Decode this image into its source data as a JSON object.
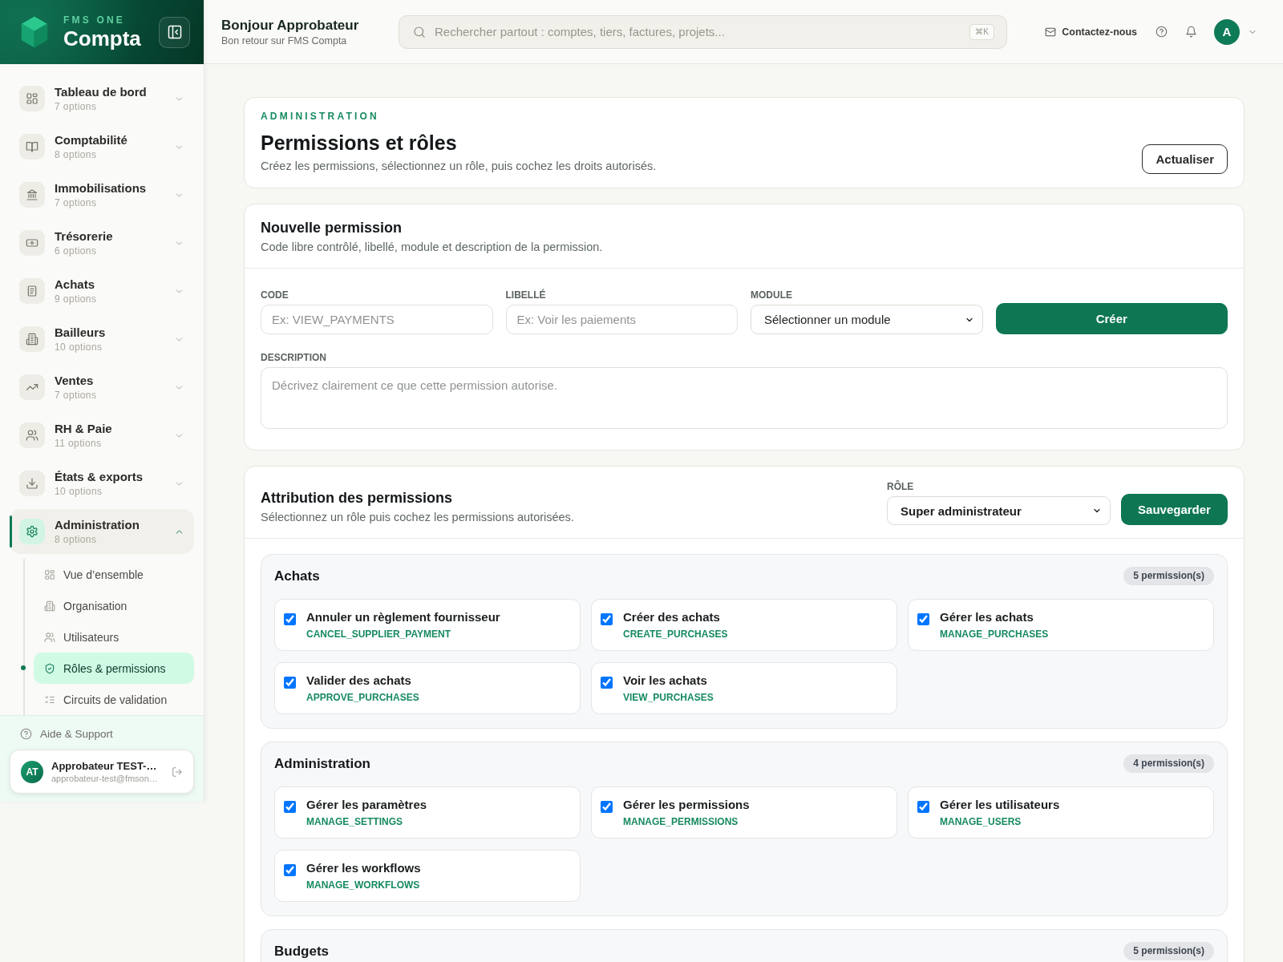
{
  "sidebar": {
    "brand": {
      "overline": "FMS ONE",
      "name": "Compta"
    },
    "nav": [
      {
        "label": "Tableau de bord",
        "count": "7 options",
        "expanded": false,
        "selected": false
      },
      {
        "label": "Comptabilité",
        "count": "8 options",
        "expanded": false,
        "selected": false
      },
      {
        "label": "Immobilisations",
        "count": "7 options",
        "expanded": false,
        "selected": false
      },
      {
        "label": "Trésorerie",
        "count": "6 options",
        "expanded": false,
        "selected": false
      },
      {
        "label": "Achats",
        "count": "9 options",
        "expanded": false,
        "selected": false
      },
      {
        "label": "Bailleurs",
        "count": "10 options",
        "expanded": false,
        "selected": false
      },
      {
        "label": "Ventes",
        "count": "7 options",
        "expanded": false,
        "selected": false
      },
      {
        "label": "RH & Paie",
        "count": "11 options",
        "expanded": false,
        "selected": false
      },
      {
        "label": "États & exports",
        "count": "10 options",
        "expanded": false,
        "selected": false
      },
      {
        "label": "Administration",
        "count": "8 options",
        "expanded": true,
        "selected": true,
        "children": [
          {
            "label": "Vue d’ensemble",
            "selected": false
          },
          {
            "label": "Organisation",
            "selected": false
          },
          {
            "label": "Utilisateurs",
            "selected": false
          },
          {
            "label": "Rôles & permissions",
            "selected": true
          },
          {
            "label": "Circuits de validation",
            "selected": false
          }
        ]
      }
    ],
    "help": "Aide & Support",
    "user": {
      "initials": "AT",
      "name": "Approbateur TEST-…",
      "email": "approbateur-test@fmson…"
    }
  },
  "topbar": {
    "greeting": "Bonjour Approbateur",
    "subtitle": "Bon retour sur FMS Compta",
    "search": {
      "placeholder": "Rechercher partout : comptes, tiers, factures, projets...",
      "shortcut": "⌘K"
    },
    "contact": "Contactez-nous",
    "avatar": "A"
  },
  "header": {
    "overline": "ADMINISTRATION",
    "title": "Permissions et rôles",
    "subtitle": "Créez les permissions, sélectionnez un rôle, puis cochez les droits autorisés.",
    "button": "Actualiser"
  },
  "new_permission": {
    "title": "Nouvelle permission",
    "subtitle": "Code libre contrôlé, libellé, module et description de la permission.",
    "fields": [
      {
        "kind": "input",
        "label": "CODE",
        "placeholder": "Ex: VIEW_PAYMENTS"
      },
      {
        "kind": "input",
        "label": "LIBELLÉ",
        "placeholder": "Ex: Voir les paiements"
      },
      {
        "kind": "select",
        "label": "MODULE",
        "value": "Sélectionner un module"
      }
    ],
    "button": "Créer",
    "description": {
      "label": "DESCRIPTION",
      "placeholder": "Décrivez clairement ce que cette permission autorise."
    }
  },
  "assignment": {
    "title": "Attribution des permissions",
    "subtitle": "Sélectionnez un rôle puis cochez les permissions autorisées.",
    "role": {
      "label": "RÔLE",
      "value": "Super administrateur"
    },
    "button": "Sauvegarder",
    "groups": [
      {
        "title": "Achats",
        "count": "5 permission(s)",
        "permissions": [
          {
            "label": "Annuler un règlement fournisseur",
            "code": "CANCEL_SUPPLIER_PAYMENT",
            "checked": true
          },
          {
            "label": "Créer des achats",
            "code": "CREATE_PURCHASES",
            "checked": true
          },
          {
            "label": "Gérer les achats",
            "code": "MANAGE_PURCHASES",
            "checked": true
          },
          {
            "label": "Valider des achats",
            "code": "APPROVE_PURCHASES",
            "checked": true
          },
          {
            "label": "Voir les achats",
            "code": "VIEW_PURCHASES",
            "checked": true
          }
        ]
      },
      {
        "title": "Administration",
        "count": "4 permission(s)",
        "permissions": [
          {
            "label": "Gérer les paramètres",
            "code": "MANAGE_SETTINGS",
            "checked": true
          },
          {
            "label": "Gérer les permissions",
            "code": "MANAGE_PERMISSIONS",
            "checked": true
          },
          {
            "label": "Gérer les utilisateurs",
            "code": "MANAGE_USERS",
            "checked": true
          },
          {
            "label": "Gérer les workflows",
            "code": "MANAGE_WORKFLOWS",
            "checked": true
          }
        ]
      },
      {
        "title": "Budgets",
        "count": "5 permission(s)"
      }
    ]
  }
}
